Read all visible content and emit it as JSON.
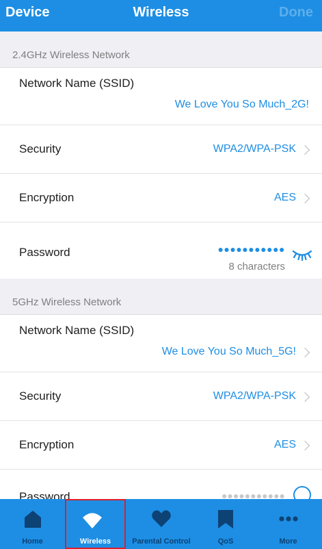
{
  "header": {
    "back_label": "Device",
    "title": "Wireless",
    "done_label": "Done"
  },
  "sections": {
    "band24": {
      "title": "2.4GHz Wireless Network",
      "ssid_label": "Network Name (SSID)",
      "ssid_value": "We Love You So Much_2G!",
      "security_label": "Security",
      "security_value": "WPA2/WPA-PSK",
      "encryption_label": "Encryption",
      "encryption_value": "AES",
      "password_label": "Password",
      "password_masked": "●●●●●●●●●●●",
      "password_hint": "8 characters"
    },
    "band5": {
      "title": "5GHz Wireless Network",
      "ssid_label": "Network Name (SSID)",
      "ssid_value": "We Love You So Much_5G!",
      "security_label": "Security",
      "security_value": "WPA2/WPA-PSK",
      "encryption_label": "Encryption",
      "encryption_value": "AES",
      "password_label": "Password",
      "password_masked": "●●●●●●●●●●●"
    }
  },
  "tabbar": {
    "tabs": [
      {
        "label": "Home",
        "icon": "home-icon"
      },
      {
        "label": "Wireless",
        "icon": "wifi-icon",
        "active": true
      },
      {
        "label": "Parental Control",
        "icon": "heart-icon"
      },
      {
        "label": "QoS",
        "icon": "bookmark-icon"
      },
      {
        "label": "More",
        "icon": "more-icon"
      }
    ]
  },
  "colors": {
    "accent": "#1d8ee4",
    "tab_inactive": "#0d4275",
    "selection_box": "#e01e2b"
  }
}
